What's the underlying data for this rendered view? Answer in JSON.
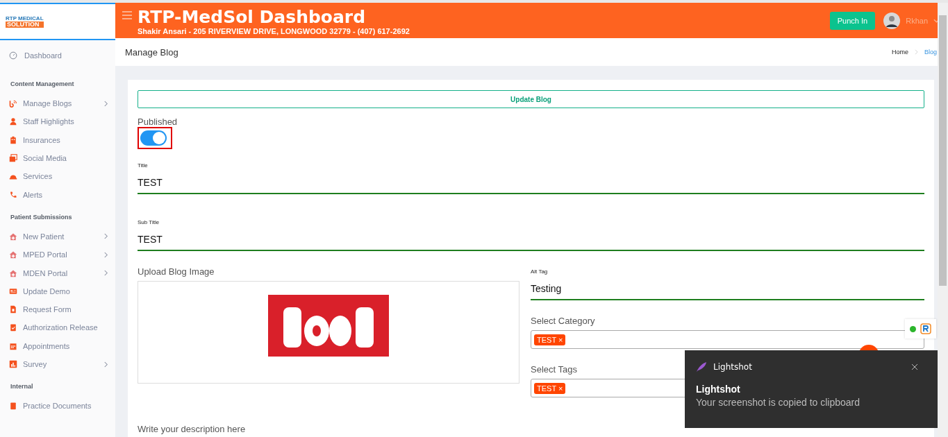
{
  "header": {
    "logo_line1": "RTP MEDICAL",
    "logo_line2": "SOLUTION",
    "title": "RTP-MedSol Dashboard",
    "subtitle": "Shakir Ansari - 205 RIVERVIEW DRIVE, LONGWOOD 32779 - (407) 617-2692",
    "punch_button": "Punch In",
    "user": "Rkhan"
  },
  "sidebar": {
    "top": {
      "label": "Dashboard",
      "selected": false
    },
    "sections": [
      {
        "title": "Content Management",
        "items": [
          {
            "label": "Manage Blogs",
            "has_submenu": true
          },
          {
            "label": "Staff Highlights",
            "has_submenu": false
          },
          {
            "label": "Insurances",
            "has_submenu": false
          },
          {
            "label": "Social Media",
            "has_submenu": false
          },
          {
            "label": "Services",
            "has_submenu": false
          },
          {
            "label": "Alerts",
            "has_submenu": false
          }
        ]
      },
      {
        "title": "Patient Submissions",
        "items": [
          {
            "label": "New Patient",
            "has_submenu": true
          },
          {
            "label": "MPED Portal",
            "has_submenu": true
          },
          {
            "label": "MDEN Portal",
            "has_submenu": true
          },
          {
            "label": "Update Demo",
            "has_submenu": false
          },
          {
            "label": "Request Form",
            "has_submenu": false
          },
          {
            "label": "Authorization Release",
            "has_submenu": false
          },
          {
            "label": "Appointments",
            "has_submenu": false
          },
          {
            "label": "Survey",
            "has_submenu": true
          }
        ]
      },
      {
        "title": "Internal",
        "items": [
          {
            "label": "Practice Documents",
            "has_submenu": false
          }
        ]
      }
    ]
  },
  "page": {
    "title": "Manage Blog",
    "breadcrumb": [
      {
        "label": "Home",
        "selected": false
      },
      {
        "label": "Blog",
        "selected": true
      }
    ]
  },
  "form": {
    "submit_button": "Update Blog",
    "published": {
      "label": "Published",
      "on": true,
      "highlighted": true
    },
    "title": {
      "label": "Title",
      "value": "TEST"
    },
    "subtitle": {
      "label": "Sub Title",
      "value": "TEST"
    },
    "image": {
      "label": "Upload Blog Image",
      "kind": "picture"
    },
    "alt_tag": {
      "label": "Alt Tag",
      "value": "Testing"
    },
    "category": {
      "label": "Select Category",
      "tags": [
        {
          "label": "TEST",
          "remove": "×"
        }
      ]
    },
    "tags": {
      "label": "Select Tags",
      "tags": [
        {
          "label": "TEST",
          "remove": "×"
        }
      ]
    },
    "description": {
      "label": "Write your description here"
    }
  },
  "notification": {
    "app": "Lightshot",
    "title": "Lightshot",
    "message": "Your screenshot is copied to clipboard"
  }
}
